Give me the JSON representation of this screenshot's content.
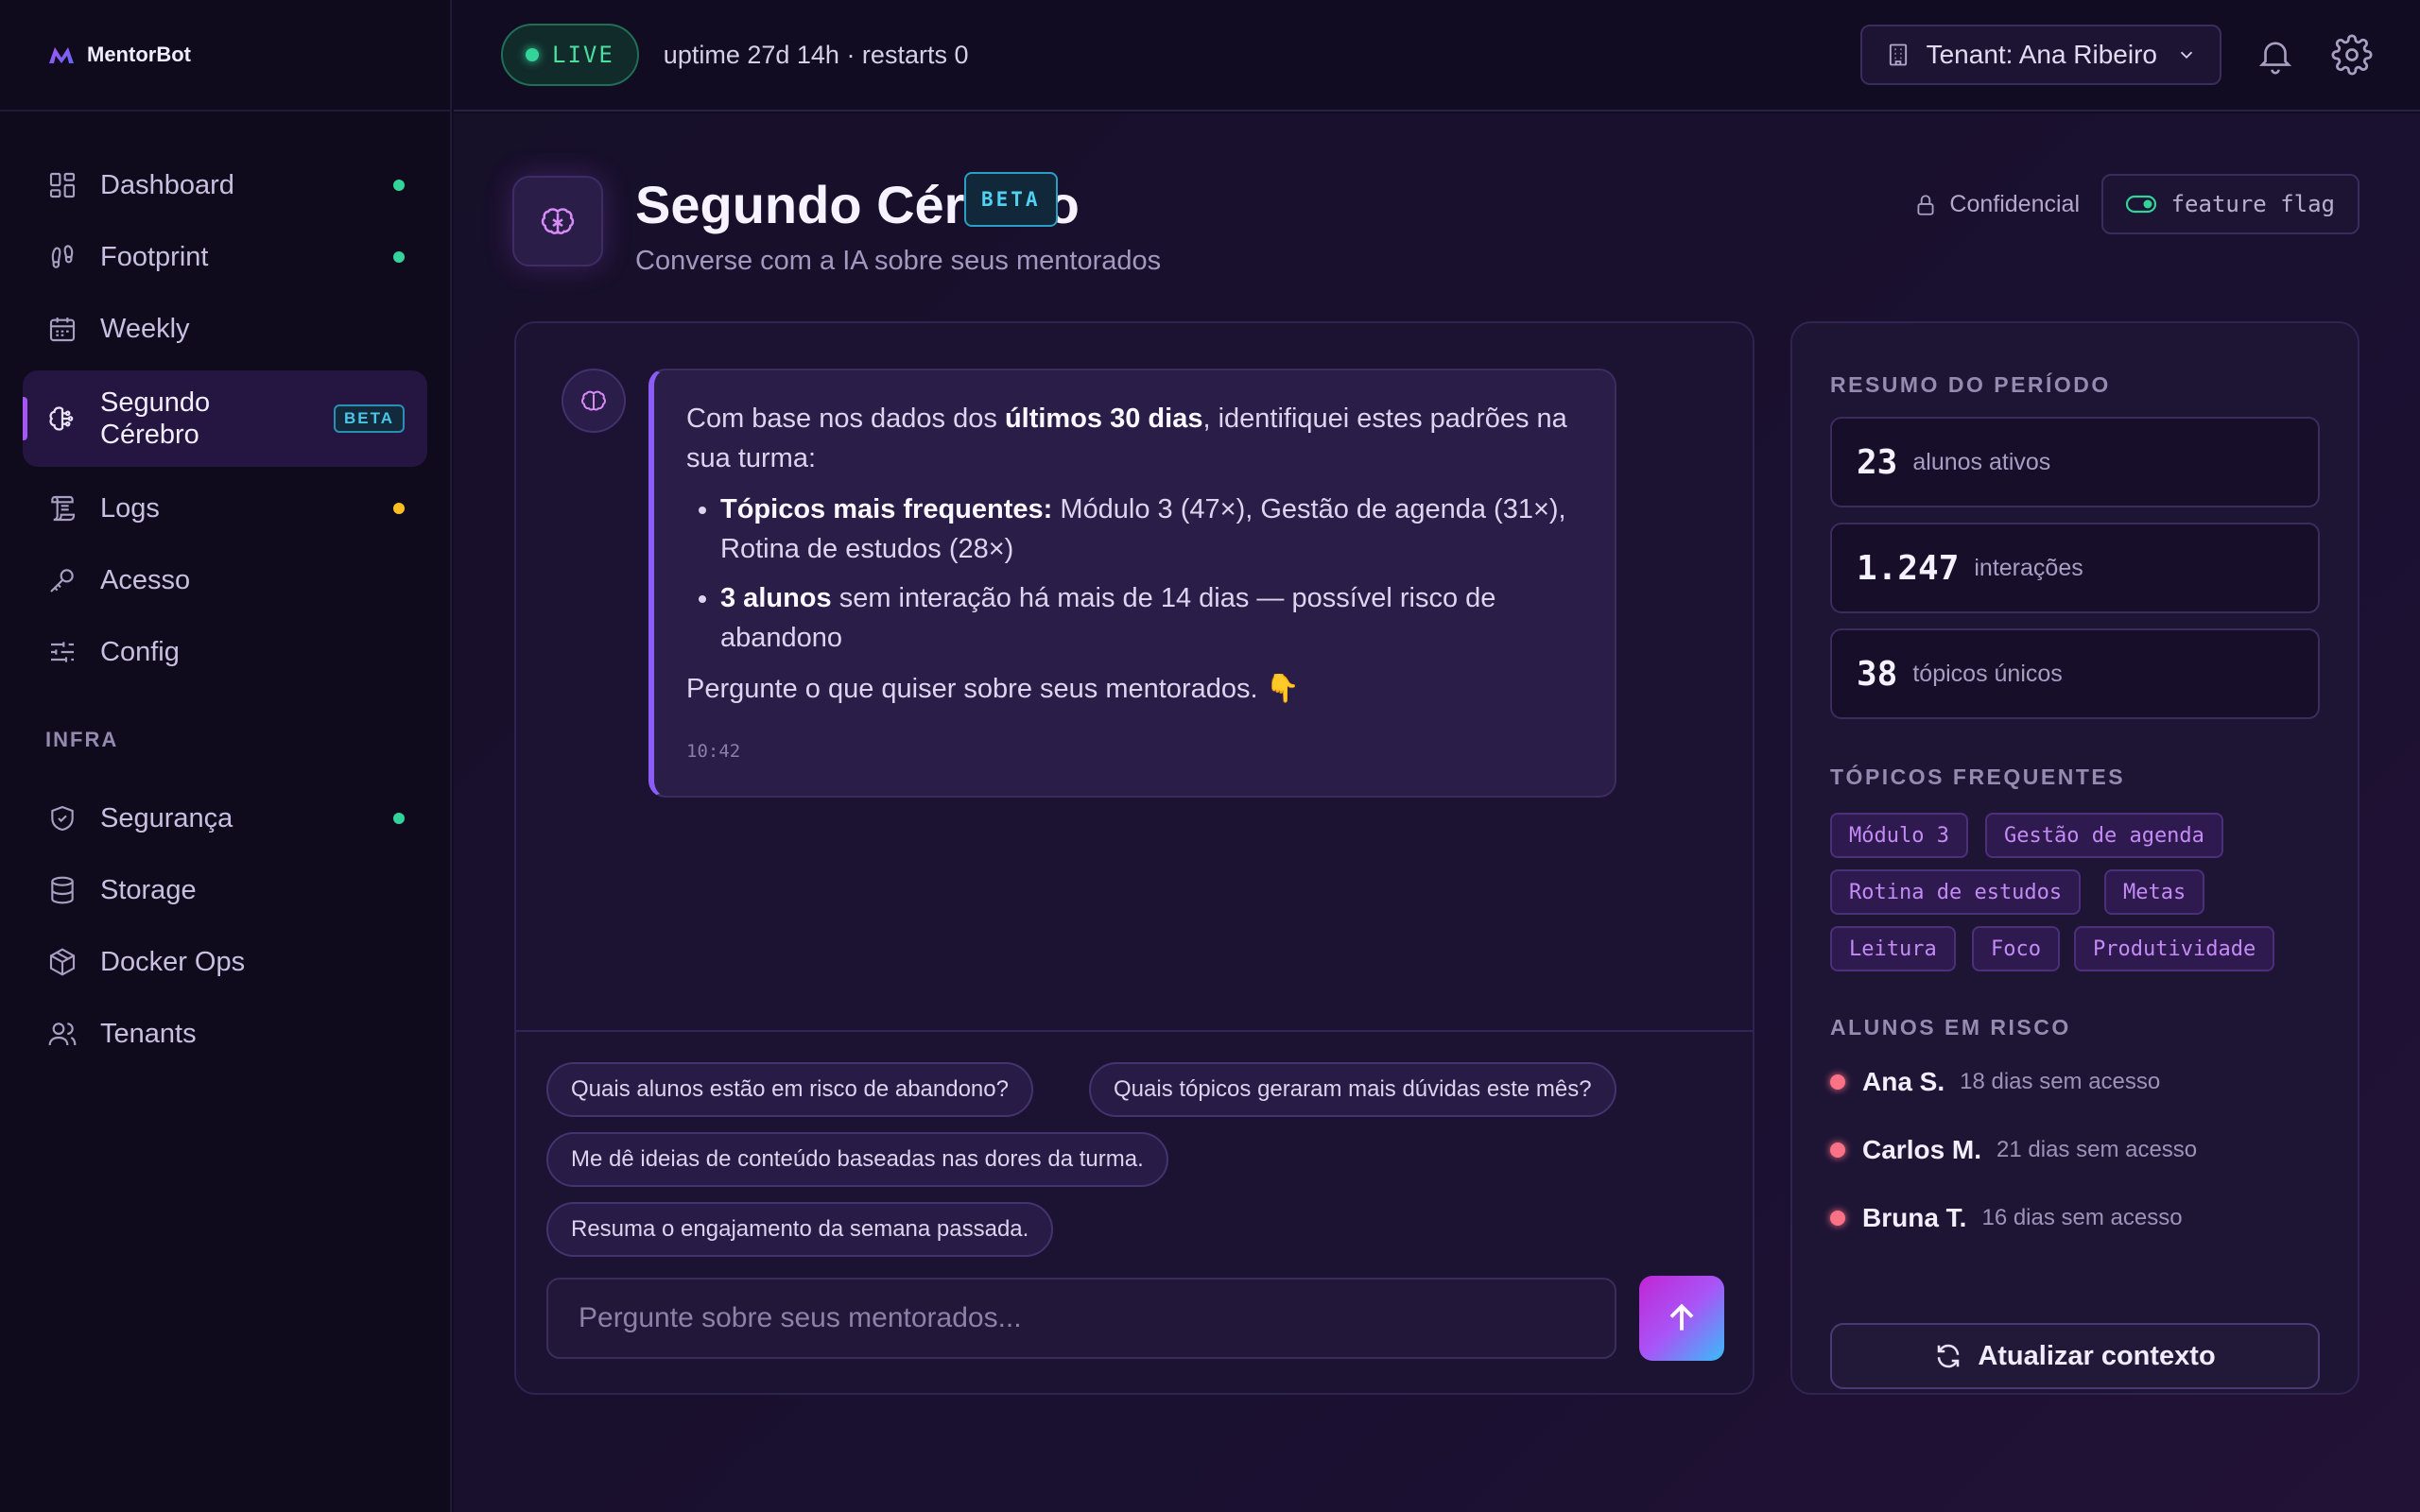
{
  "app": {
    "name": "MentorBot"
  },
  "sidebar": {
    "items": [
      {
        "label": "Dashboard",
        "icon": "grid-icon",
        "status": "green"
      },
      {
        "label": "Footprint",
        "icon": "footprint-icon",
        "status": "green"
      },
      {
        "label": "Weekly",
        "icon": "calendar-icon",
        "status": null
      },
      {
        "label": "Segundo Cérebro",
        "icon": "brain-icon",
        "badge": "BETA",
        "active": true
      },
      {
        "label": "Logs",
        "icon": "scroll-icon",
        "status": "yellow"
      },
      {
        "label": "Acesso",
        "icon": "key-icon",
        "status": null
      },
      {
        "label": "Config",
        "icon": "sliders-icon",
        "status": null
      }
    ],
    "section_infra": "INFRA",
    "infra_items": [
      {
        "label": "Segurança",
        "icon": "shield-icon",
        "status": "green"
      },
      {
        "label": "Storage",
        "icon": "database-icon",
        "status": null
      },
      {
        "label": "Docker Ops",
        "icon": "box-icon",
        "status": null
      },
      {
        "label": "Tenants",
        "icon": "users-icon",
        "status": null
      }
    ]
  },
  "topbar": {
    "live_label": "LIVE",
    "uptime": "uptime 27d 14h · restarts 0",
    "tenant": "Tenant: Ana Ribeiro"
  },
  "page": {
    "title": "Segundo Cérebro",
    "badge": "BETA",
    "subtitle": "Converse com a IA sobre seus mentorados",
    "confidential": "Confidencial",
    "feature_flag": "feature flag"
  },
  "chat": {
    "message": {
      "intro_1": "Com base nos dados dos ",
      "intro_bold": "últimos 30 dias",
      "intro_2": ", identifiquei estes padrões na sua turma:",
      "bullet1_bold": "Tópicos mais frequentes:",
      "bullet1_text": " Módulo 3 (47×), Gestão de agenda (31×), Rotina de estudos (28×)",
      "bullet2_bold": "3 alunos",
      "bullet2_text": " sem interação há mais de 14 dias — possível risco de abandono",
      "closing": "Pergunte o que quiser sobre seus mentorados. 👇",
      "time": "10:42"
    },
    "suggestions": [
      "Quais alunos estão em risco de abandono?",
      "Quais tópicos geraram mais dúvidas este mês?",
      "Me dê ideias de conteúdo baseadas nas dores da turma.",
      "Resuma o engajamento da semana passada."
    ],
    "input_placeholder": "Pergunte sobre seus mentorados..."
  },
  "summary": {
    "title": "RESUMO DO PERÍODO",
    "stats": [
      {
        "value": "23",
        "label": "alunos ativos"
      },
      {
        "value": "1.247",
        "label": "interações"
      },
      {
        "value": "38",
        "label": "tópicos únicos"
      }
    ],
    "topics_title": "TÓPICOS FREQUENTES",
    "topics": [
      "Módulo 3",
      "Gestão de agenda",
      "Rotina de estudos",
      "Metas",
      "Leitura",
      "Foco",
      "Produtividade"
    ],
    "risk_title": "ALUNOS EM RISCO",
    "risk": [
      {
        "name": "Ana S.",
        "desc": "18 dias sem acesso"
      },
      {
        "name": "Carlos M.",
        "desc": "21 dias sem acesso"
      },
      {
        "name": "Bruna T.",
        "desc": "16 dias sem acesso"
      }
    ],
    "refresh_label": "Atualizar contexto"
  },
  "colors": {
    "accent": "#a855f7",
    "status_green": "#34d399",
    "status_yellow": "#fbbf24",
    "risk_red": "#fb7185",
    "beta_cyan": "#52d0f2"
  }
}
